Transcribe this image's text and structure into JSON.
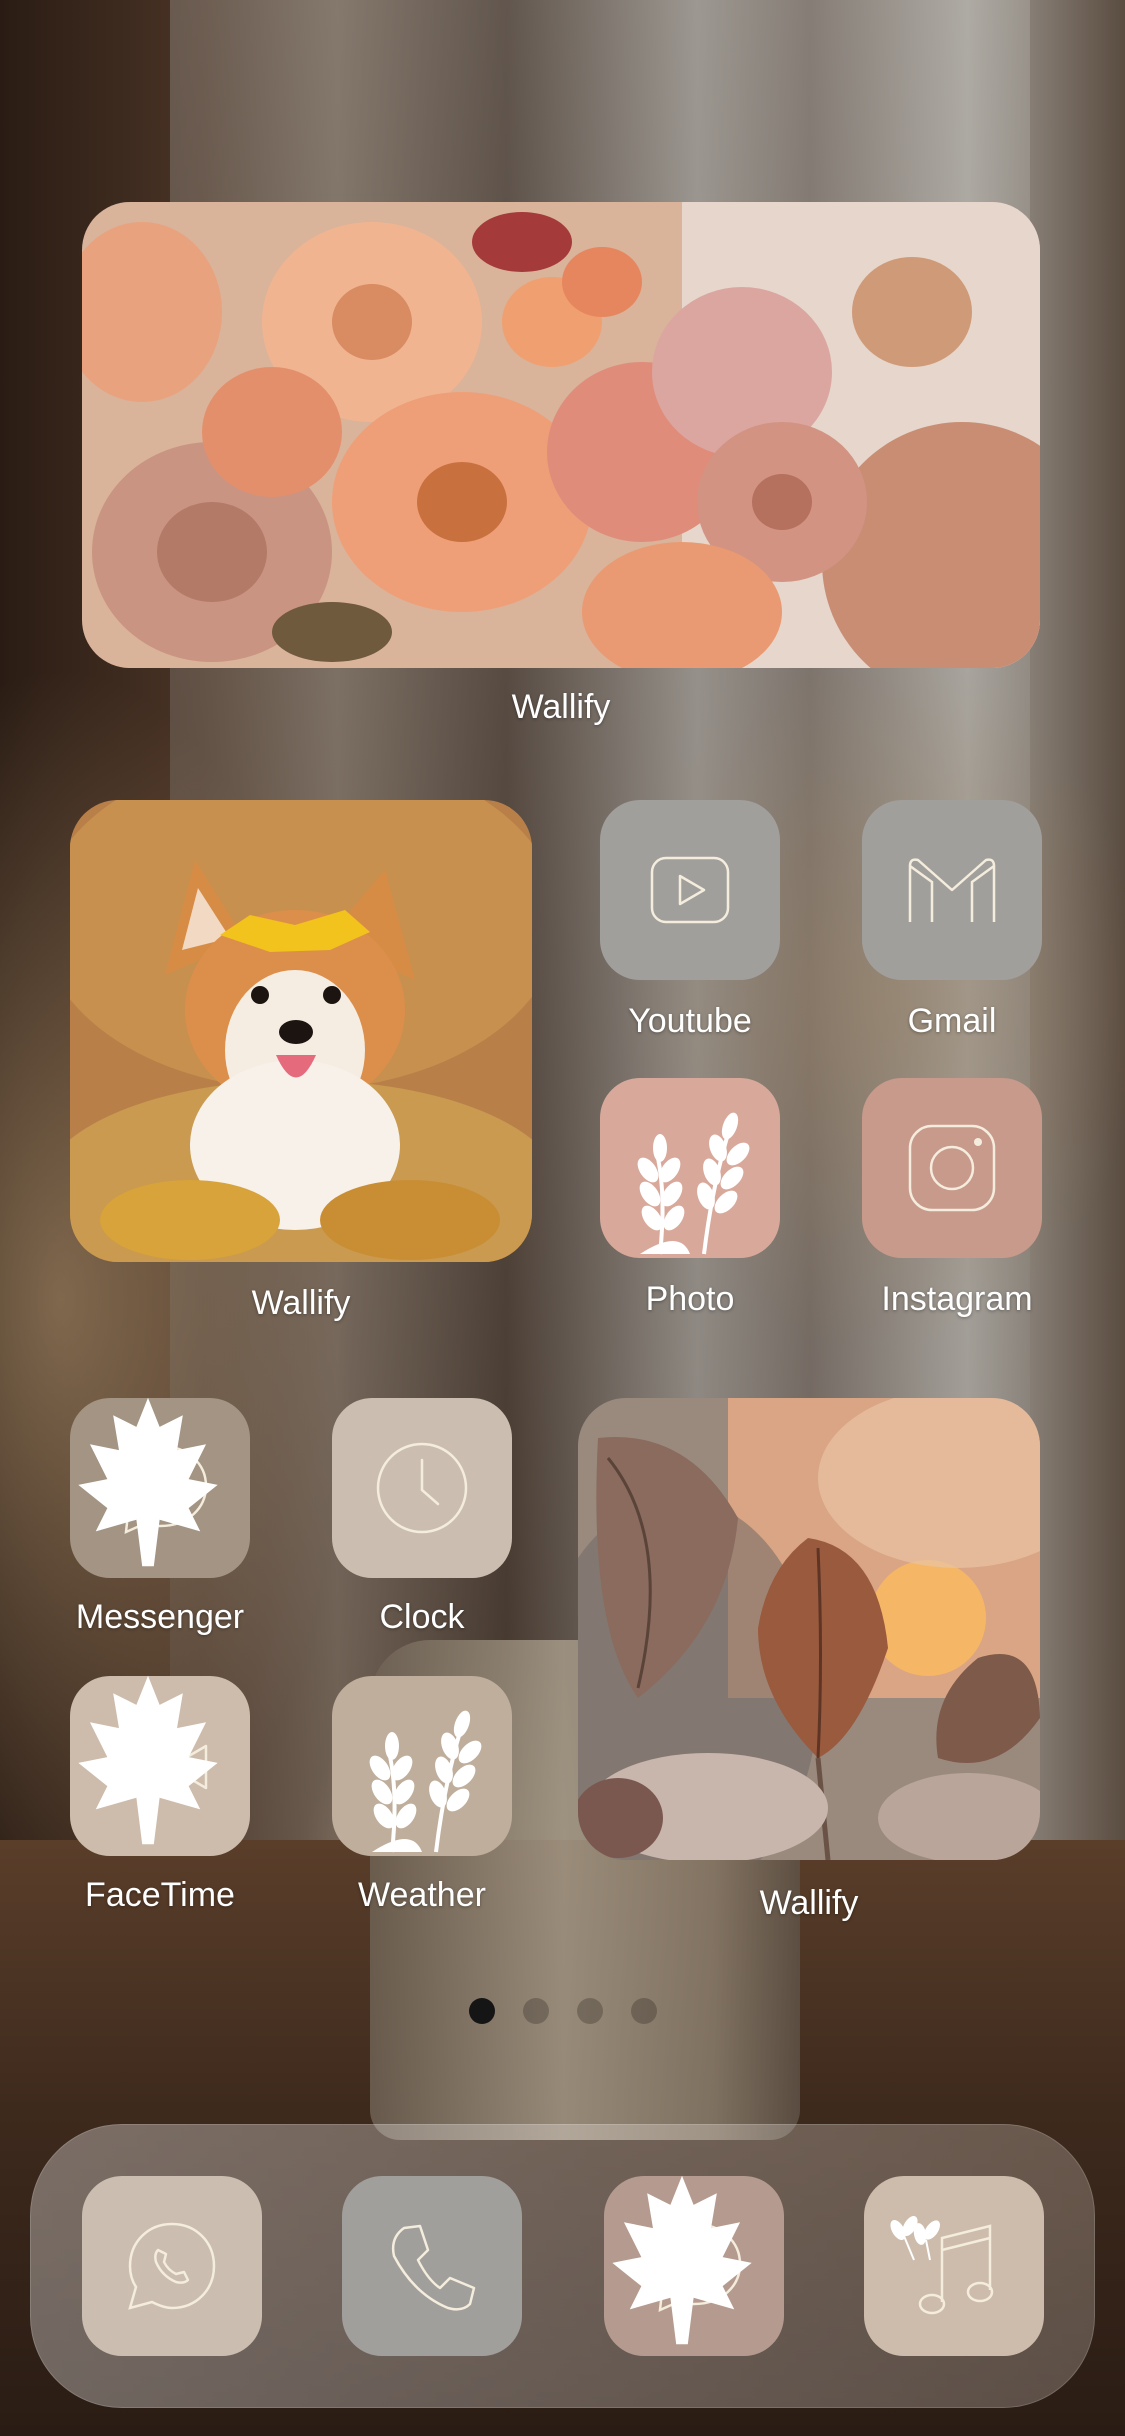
{
  "colors": {
    "gray_tile": "#a19f9c",
    "pink_tile": "#d8a99b",
    "mauve_tile": "#b59b8f",
    "taupe_tile": "#a39483",
    "beige_tile": "#cdbcab",
    "sand_tile": "#cbbeb0",
    "line_cream": "#f4ecdc"
  },
  "widgets": {
    "top": {
      "label": "Wallify",
      "image": "autumn-flower-bouquet"
    },
    "middle_left": {
      "label": "Wallify",
      "image": "corgi-in-autumn-leaves"
    },
    "bottom_right": {
      "label": "Wallify",
      "image": "autumn-leaves-at-sunset"
    }
  },
  "apps": [
    {
      "id": "youtube",
      "label": "Youtube",
      "icon": "play-icon"
    },
    {
      "id": "gmail",
      "label": "Gmail",
      "icon": "mail-m-icon"
    },
    {
      "id": "photo",
      "label": "Photo",
      "icon": "wheat-icon"
    },
    {
      "id": "instagram",
      "label": "Instagram",
      "icon": "camera-icon"
    },
    {
      "id": "messenger",
      "label": "Messenger",
      "icon": "messenger-icon"
    },
    {
      "id": "clock",
      "label": "Clock",
      "icon": "clock-icon"
    },
    {
      "id": "facetime",
      "label": "FaceTime",
      "icon": "video-camera-icon"
    },
    {
      "id": "weather",
      "label": "Weather",
      "icon": "wheat-icon"
    }
  ],
  "page_indicator": {
    "count": 4,
    "active": 1
  },
  "dock": [
    {
      "id": "whatsapp",
      "icon": "whatsapp-icon"
    },
    {
      "id": "phone",
      "icon": "phone-icon"
    },
    {
      "id": "messenger",
      "icon": "messenger-icon"
    },
    {
      "id": "music",
      "icon": "music-note-icon"
    }
  ]
}
